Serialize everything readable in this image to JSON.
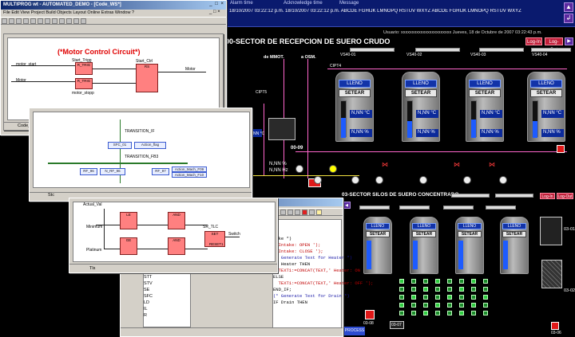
{
  "alarm": {
    "col_time": "Alarm time",
    "col_ack": "Acknowledge time",
    "col_msg": "Message",
    "row": "* 18/10/2007 03:22:12 p.m. 18/10/2007 03:22:12 p.m. ABCDE FGHIJK LMNOPQ RSTUV WXYZ ABCDE FGHIJK LMNOPQ RSTUV WXYZ"
  },
  "user_line": "Usuario: xxxxxxxxxxxxxxxxxxxxxxx     Jueves, 18 de Octubre de 2007 03:22:43 p.m.",
  "scada1": {
    "title": "00-SECTOR DE RECEPCION DE SUERO CRUDO",
    "log_in": "Log-In",
    "log_out": "Log-Out",
    "de_mmot": "de MMOT.",
    "a_osm": "a OSM.",
    "cipt4": "CIPT4",
    "cipt5": "CIPT5",
    "silos": [
      {
        "tag": "VS40-01",
        "state": "LLENO",
        "btn": "SETEAR",
        "temp": "N,NN °C",
        "pct": "N,NN %",
        "level": 0.55
      },
      {
        "tag": "VS40-02",
        "state": "LLENO",
        "btn": "SETEAR",
        "temp": "N,NN °C",
        "pct": "N,NN %",
        "level": 0.45
      },
      {
        "tag": "VS40-03",
        "state": "LLENO",
        "btn": "SETEAR",
        "temp": "N,NN °C",
        "pct": "N,NN %",
        "level": 0.5
      },
      {
        "tag": "VS40-04",
        "state": "LLENO",
        "btn": "SETEAR",
        "temp": "N,NN °C",
        "pct": "N,NN %",
        "level": 0.45
      }
    ],
    "unit_0009": "00-09",
    "flow1": "N,NN %",
    "flow2": "N,NN Hz",
    "nn_c": "N,NN °C"
  },
  "scada2": {
    "title": "03-SECTOR SILOS DE SUERO CONCENTRADO",
    "log_in": "Log-In",
    "log_out": "Log-Out",
    "silos": [
      {
        "state": "LLENO",
        "btn": "SETEAR"
      },
      {
        "state": "LLENO",
        "btn": "SETEAR"
      },
      {
        "state": "LLENO",
        "btn": "SETEAR"
      },
      {
        "state": "LLENO",
        "btn": "SETEAR"
      }
    ],
    "unit_0301": "03-01",
    "unit_0302": "03-02",
    "unit_0307": "03-07",
    "unit_0308": "03-08",
    "unit_0306": "03-06",
    "process_btn": "L PROCESS"
  },
  "ide": {
    "title": "MULTIPROG wt - AUTOMATED_DEMO - [Code_WS*]",
    "menu": "File  Edit  View  Project  Build  Objects  Layout  Online  Extras  Window  ?",
    "fbd_title": "(*Motor Control Circuit*)",
    "fbd_labels": [
      "Start_Trigg",
      "motor_start",
      "Start_Ctrl",
      "Motor",
      "motor_stopp",
      "Motor",
      "RS",
      "R_TRIG",
      "R_TRIG"
    ],
    "status1": "Code_WS",
    "status2": "Stc",
    "status3": "Tls",
    "sfc_labels": [
      "TRANSITION_IF",
      "SFC_01",
      "Action_flag",
      "TRANSITION_FB3",
      "RF_96",
      "N_RF_96",
      "RF_97",
      "Action_Mach_F09",
      "Action_Mach_F10"
    ],
    "ld_labels": [
      "Actual_Val",
      "Minimum",
      "Platinum",
      "LE",
      "AND",
      "GE",
      "AND",
      "SR_TLC",
      "SET",
      "RESET1",
      "Switch"
    ],
    "code_lines": [
      "take *)",
      ", Intake: OPEN ');",
      ", Intake: CLOSE ');",
      "(* Generate Text for Heater *)",
      "IF Heater THEN",
      "  TEXT1:=CONCAT(TEXT,' Heater: ON ');",
      "ELSE",
      "  TEXT1:=CONCAT(TEXT,' Heater: OFF ');",
      "END_IF;",
      "(* Generate Text for Drain *)",
      "IF Drain THEN"
    ],
    "tree_items": [
      "CON_TEXT",
      "STT",
      "STV",
      "SE",
      "SFC",
      "LD",
      "IL",
      "R"
    ]
  }
}
